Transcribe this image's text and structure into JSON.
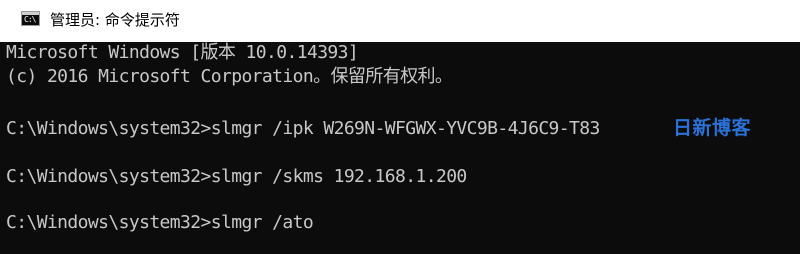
{
  "window": {
    "title": "管理员: 命令提示符",
    "icon": "cmd-console-icon",
    "icon_glyph": "C:\\",
    "background": "#0c0c0c",
    "text_color": "#c8c8c8"
  },
  "console": {
    "lines": [
      "Microsoft Windows [版本 10.0.14393]",
      "(c) 2016 Microsoft Corporation。保留所有权利。",
      "C:\\Windows\\system32>slmgr /ipk W269N-WFGWX-YVC9B-4J6C9-T83",
      "C:\\Windows\\system32>slmgr /skms 192.168.1.200",
      "C:\\Windows\\system32>slmgr /ato"
    ]
  },
  "watermark": {
    "text": "日新博客",
    "color": "#2a72d8"
  }
}
